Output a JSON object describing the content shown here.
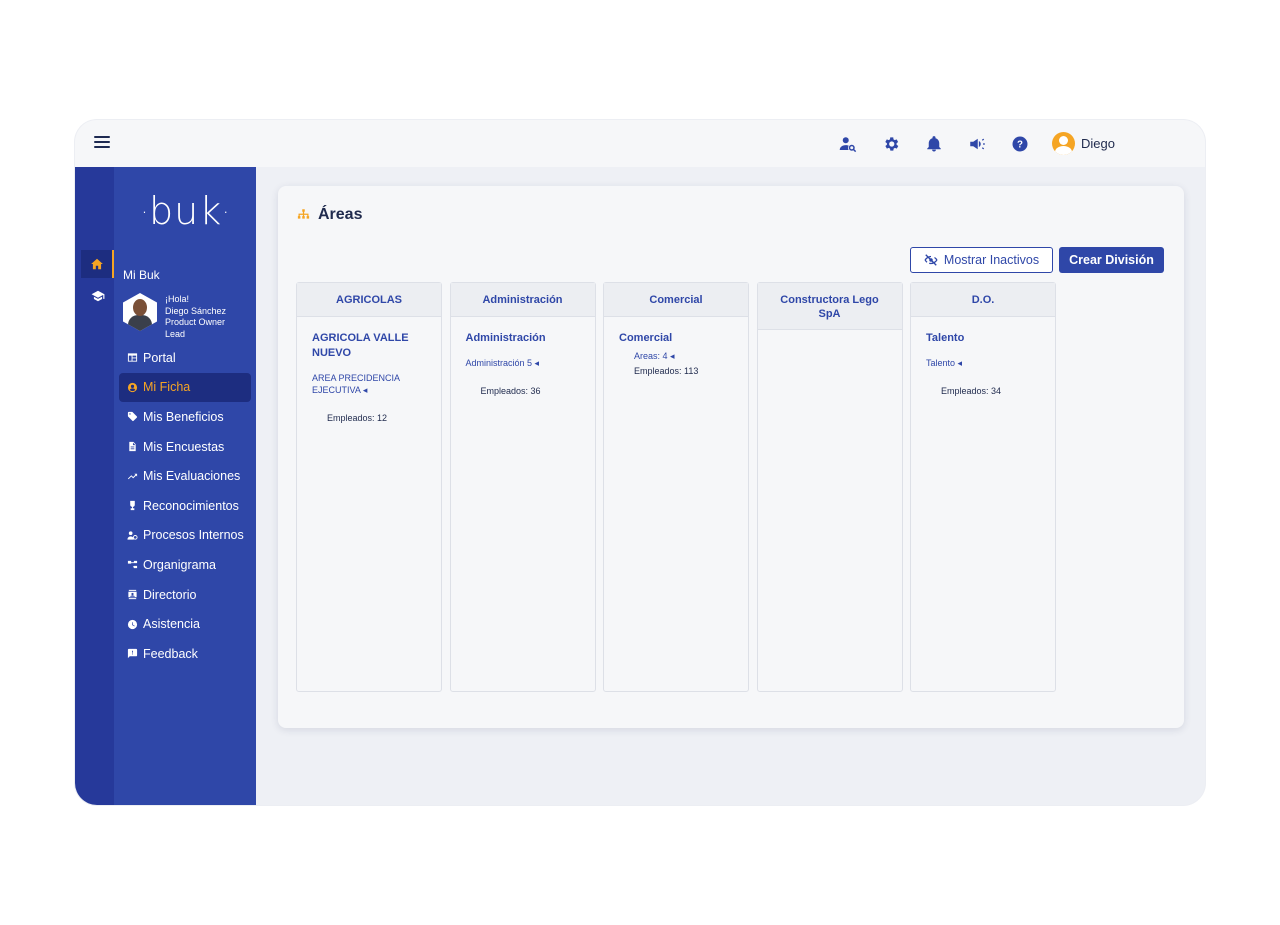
{
  "topbar": {
    "icons": [
      "person-search-icon",
      "gear-icon",
      "bell-icon",
      "megaphone-icon",
      "help-icon"
    ],
    "user_name": "Diego"
  },
  "rail": {
    "items": [
      "home-icon",
      "graduation-cap-icon"
    ]
  },
  "sidebar": {
    "logo": "buk",
    "section_title": "Mi Buk",
    "profile": {
      "greeting": "¡Hola!",
      "name": "Diego Sánchez",
      "role_line1": "Product Owner",
      "role_line2": "Lead"
    },
    "items": [
      {
        "label": "Portal",
        "icon": "portal-icon"
      },
      {
        "label": "Mi Ficha",
        "icon": "user-circle-icon"
      },
      {
        "label": "Mis Beneficios",
        "icon": "tag-icon"
      },
      {
        "label": "Mis Encuestas",
        "icon": "document-icon"
      },
      {
        "label": "Mis Evaluaciones",
        "icon": "trend-icon"
      },
      {
        "label": "Reconocimientos",
        "icon": "trophy-icon"
      },
      {
        "label": "Procesos Internos",
        "icon": "process-icon"
      },
      {
        "label": "Organigrama",
        "icon": "org-icon"
      },
      {
        "label": "Directorio",
        "icon": "contact-icon"
      },
      {
        "label": "Asistencia",
        "icon": "clock-icon"
      },
      {
        "label": "Feedback",
        "icon": "feedback-icon"
      }
    ]
  },
  "main": {
    "title": "Áreas",
    "show_inactive": "Mostrar Inactivos",
    "create_division": "Crear División",
    "columns": [
      {
        "header": "AGRICOLAS",
        "division": "AGRICOLA VALLE NUEVO",
        "sub": "AREA PRECIDENCIA EJECUTIVA ◂",
        "employees": "Empleados: 12"
      },
      {
        "header": "Administración",
        "division": "Administración",
        "sub": "Administración 5 ◂",
        "employees": "Empleados: 36"
      },
      {
        "header": "Comercial",
        "division": "Comercial",
        "sub": "Areas: 4 ◂",
        "employees": "Empleados: 113"
      },
      {
        "header": "Constructora Lego SpA"
      },
      {
        "header": "D.O.",
        "division": "Talento",
        "sub": "Talento ◂",
        "employees": "Empleados: 34"
      }
    ]
  },
  "colors": {
    "primary": "#2f47a8",
    "accent": "#f5a524",
    "sidebar_dark": "#1d2d80"
  }
}
